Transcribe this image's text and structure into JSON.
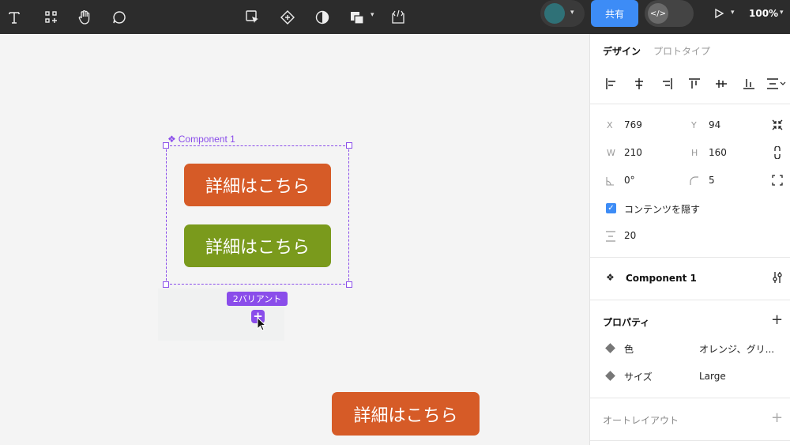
{
  "toolbar": {
    "tools": [
      "text-tool",
      "component-tool",
      "hand-tool",
      "comment-tool"
    ],
    "center_tools": [
      "select-matching-layers",
      "create-component",
      "mask-tool",
      "boolean-ops",
      "dev-handoff"
    ],
    "share_label": "共有",
    "zoom_label": "100%",
    "avatar_color": "#2f7177"
  },
  "canvas": {
    "component_label": "Component 1",
    "variant_buttons": [
      {
        "label": "詳細はこちら",
        "color": "#d65b27"
      },
      {
        "label": "詳細はこちら",
        "color": "#7a9a1c"
      }
    ],
    "variants_badge": "2バリアント",
    "instance_button": {
      "label": "詳細はこちら",
      "color": "#d65b27"
    },
    "selection_color": "#8a4dea"
  },
  "panel": {
    "tabs": {
      "design": "デザイン",
      "prototype": "プロトタイプ"
    },
    "x_label": "X",
    "x_value": "769",
    "y_label": "Y",
    "y_value": "94",
    "w_label": "W",
    "w_value": "210",
    "h_label": "H",
    "h_value": "160",
    "rotation_value": "0°",
    "radius_value": "5",
    "clip_label": "コンテンツを隠す",
    "gap_value": "20",
    "component_name": "Component 1",
    "properties_title": "プロパティ",
    "properties": [
      {
        "name": "色",
        "value": "オレンジ、グリ..."
      },
      {
        "name": "サイズ",
        "value": "Large"
      }
    ],
    "autolayout_title": "オートレイアウト"
  }
}
